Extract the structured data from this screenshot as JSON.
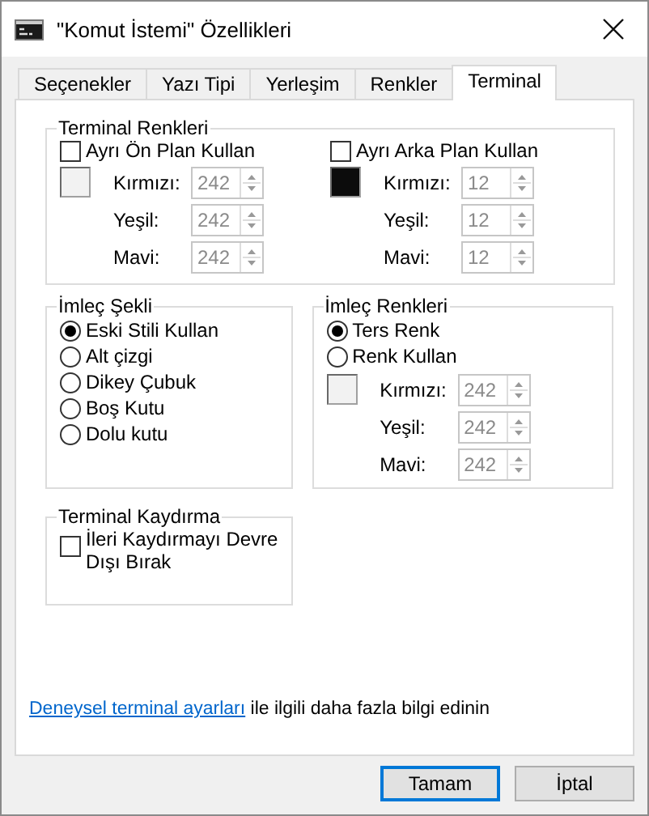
{
  "window": {
    "title": "\"Komut İstemi\" Özellikleri"
  },
  "tabs": [
    {
      "label": "Seçenekler",
      "selected": false
    },
    {
      "label": "Yazı Tipi",
      "selected": false
    },
    {
      "label": "Yerleşim",
      "selected": false
    },
    {
      "label": "Renkler",
      "selected": false
    },
    {
      "label": "Terminal",
      "selected": true
    }
  ],
  "terminal_colors": {
    "title": "Terminal Renkleri",
    "groups": [
      {
        "checkbox": {
          "label": "Ayrı Ön Plan Kullan",
          "checked": false
        },
        "swatch": {
          "color": "#f2f2f2"
        },
        "fields": [
          {
            "label": "Kırmızı:",
            "value": "242",
            "disabled": true
          },
          {
            "label": "Yeşil:",
            "value": "242",
            "disabled": true
          },
          {
            "label": "Mavi:",
            "value": "242",
            "disabled": true
          }
        ]
      },
      {
        "checkbox": {
          "label": "Ayrı Arka Plan Kullan",
          "checked": false
        },
        "swatch": {
          "color": "#0c0c0c"
        },
        "fields": [
          {
            "label": "Kırmızı:",
            "value": "12",
            "disabled": true
          },
          {
            "label": "Yeşil:",
            "value": "12",
            "disabled": true
          },
          {
            "label": "Mavi:",
            "value": "12",
            "disabled": true
          }
        ]
      }
    ]
  },
  "cursor_shape": {
    "title": "İmleç Şekli",
    "options": [
      {
        "label": "Eski Stili Kullan",
        "selected": true
      },
      {
        "label": "Alt çizgi",
        "selected": false
      },
      {
        "label": "Dikey Çubuk",
        "selected": false
      },
      {
        "label": "Boş Kutu",
        "selected": false
      },
      {
        "label": "Dolu kutu",
        "selected": false
      }
    ]
  },
  "cursor_colors": {
    "title": "İmleç Renkleri",
    "options": [
      {
        "label": "Ters Renk",
        "selected": true
      },
      {
        "label": "Renk Kullan",
        "selected": false
      }
    ],
    "swatch": {
      "color": "#f2f2f2"
    },
    "fields": [
      {
        "label": "Kırmızı:",
        "value": "242",
        "disabled": true
      },
      {
        "label": "Yeşil:",
        "value": "242",
        "disabled": true
      },
      {
        "label": "Mavi:",
        "value": "242",
        "disabled": true
      }
    ]
  },
  "scrolling": {
    "title": "Terminal Kaydırma",
    "checkbox": {
      "label": "İleri Kaydırmayı Devre Dışı Bırak",
      "checked": false
    }
  },
  "footer": {
    "link": "Deneysel terminal ayarları",
    "text": "ile ilgili daha fazla bilgi edinin"
  },
  "buttons": [
    {
      "label": "Tamam",
      "default": true
    },
    {
      "label": "İptal",
      "default": false
    }
  ]
}
